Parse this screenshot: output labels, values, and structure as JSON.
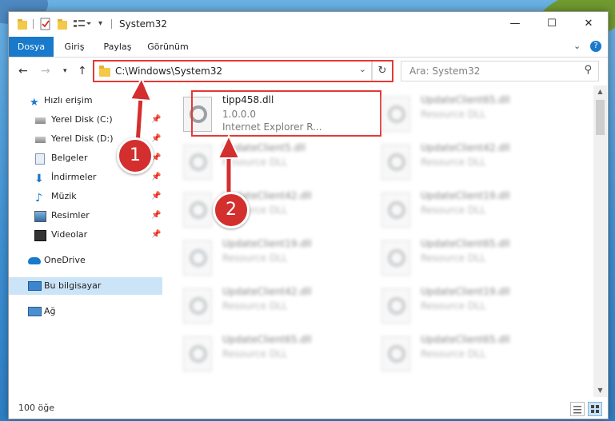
{
  "window": {
    "title": "System32"
  },
  "ribbon": {
    "tabs": [
      "Dosya",
      "Giriş",
      "Paylaş",
      "Görünüm"
    ]
  },
  "address": {
    "path": "C:\\Windows\\System32"
  },
  "search": {
    "placeholder": "Ara: System32"
  },
  "sidebar": {
    "items": [
      {
        "label": "Hızlı erişim",
        "icon": "star-icon"
      },
      {
        "label": "Yerel Disk (C:)",
        "icon": "drive-icon",
        "pinned": true
      },
      {
        "label": "Yerel Disk (D:)",
        "icon": "drive-icon",
        "pinned": true
      },
      {
        "label": "Belgeler",
        "icon": "documents-icon",
        "pinned": true
      },
      {
        "label": "İndirmeler",
        "icon": "download-icon",
        "pinned": true
      },
      {
        "label": "Müzik",
        "icon": "music-icon",
        "pinned": true
      },
      {
        "label": "Resimler",
        "icon": "pictures-icon",
        "pinned": true
      },
      {
        "label": "Videolar",
        "icon": "videos-icon",
        "pinned": true
      },
      {
        "label": "OneDrive",
        "icon": "cloud-icon"
      },
      {
        "label": "Bu bilgisayar",
        "icon": "computer-icon",
        "selected": true
      },
      {
        "label": "Ağ",
        "icon": "network-icon"
      }
    ]
  },
  "files": [
    {
      "name": "tipp458.dll",
      "version": "1.0.0.0",
      "desc": "Internet Explorer R..."
    },
    {
      "name": "UpdateClient65.dll",
      "desc": "Resource DLL"
    },
    {
      "name": "UpdateClient5.dll",
      "desc": "Resource DLL"
    },
    {
      "name": "UpdateClient42.dll",
      "desc": "Resource DLL"
    },
    {
      "name": "UpdateClient42.dll",
      "desc": "Resource DLL"
    },
    {
      "name": "UpdateClient19.dll",
      "desc": "Resource DLL"
    },
    {
      "name": "UpdateClient19.dll",
      "desc": "Resource DLL"
    },
    {
      "name": "UpdateClient65.dll",
      "desc": "Resource DLL"
    },
    {
      "name": "UpdateClient42.dll",
      "desc": "Resource DLL"
    },
    {
      "name": "UpdateClient19.dll",
      "desc": "Resource DLL"
    },
    {
      "name": "UpdateClient65.dll",
      "desc": "Resource DLL"
    },
    {
      "name": "UpdateClient65.dll",
      "desc": "Resource DLL"
    }
  ],
  "status": {
    "count": "100 öğe"
  },
  "callouts": [
    "1",
    "2"
  ],
  "colors": {
    "accent": "#1979ca",
    "highlight": "#e53935",
    "selected": "#cce4f7"
  }
}
